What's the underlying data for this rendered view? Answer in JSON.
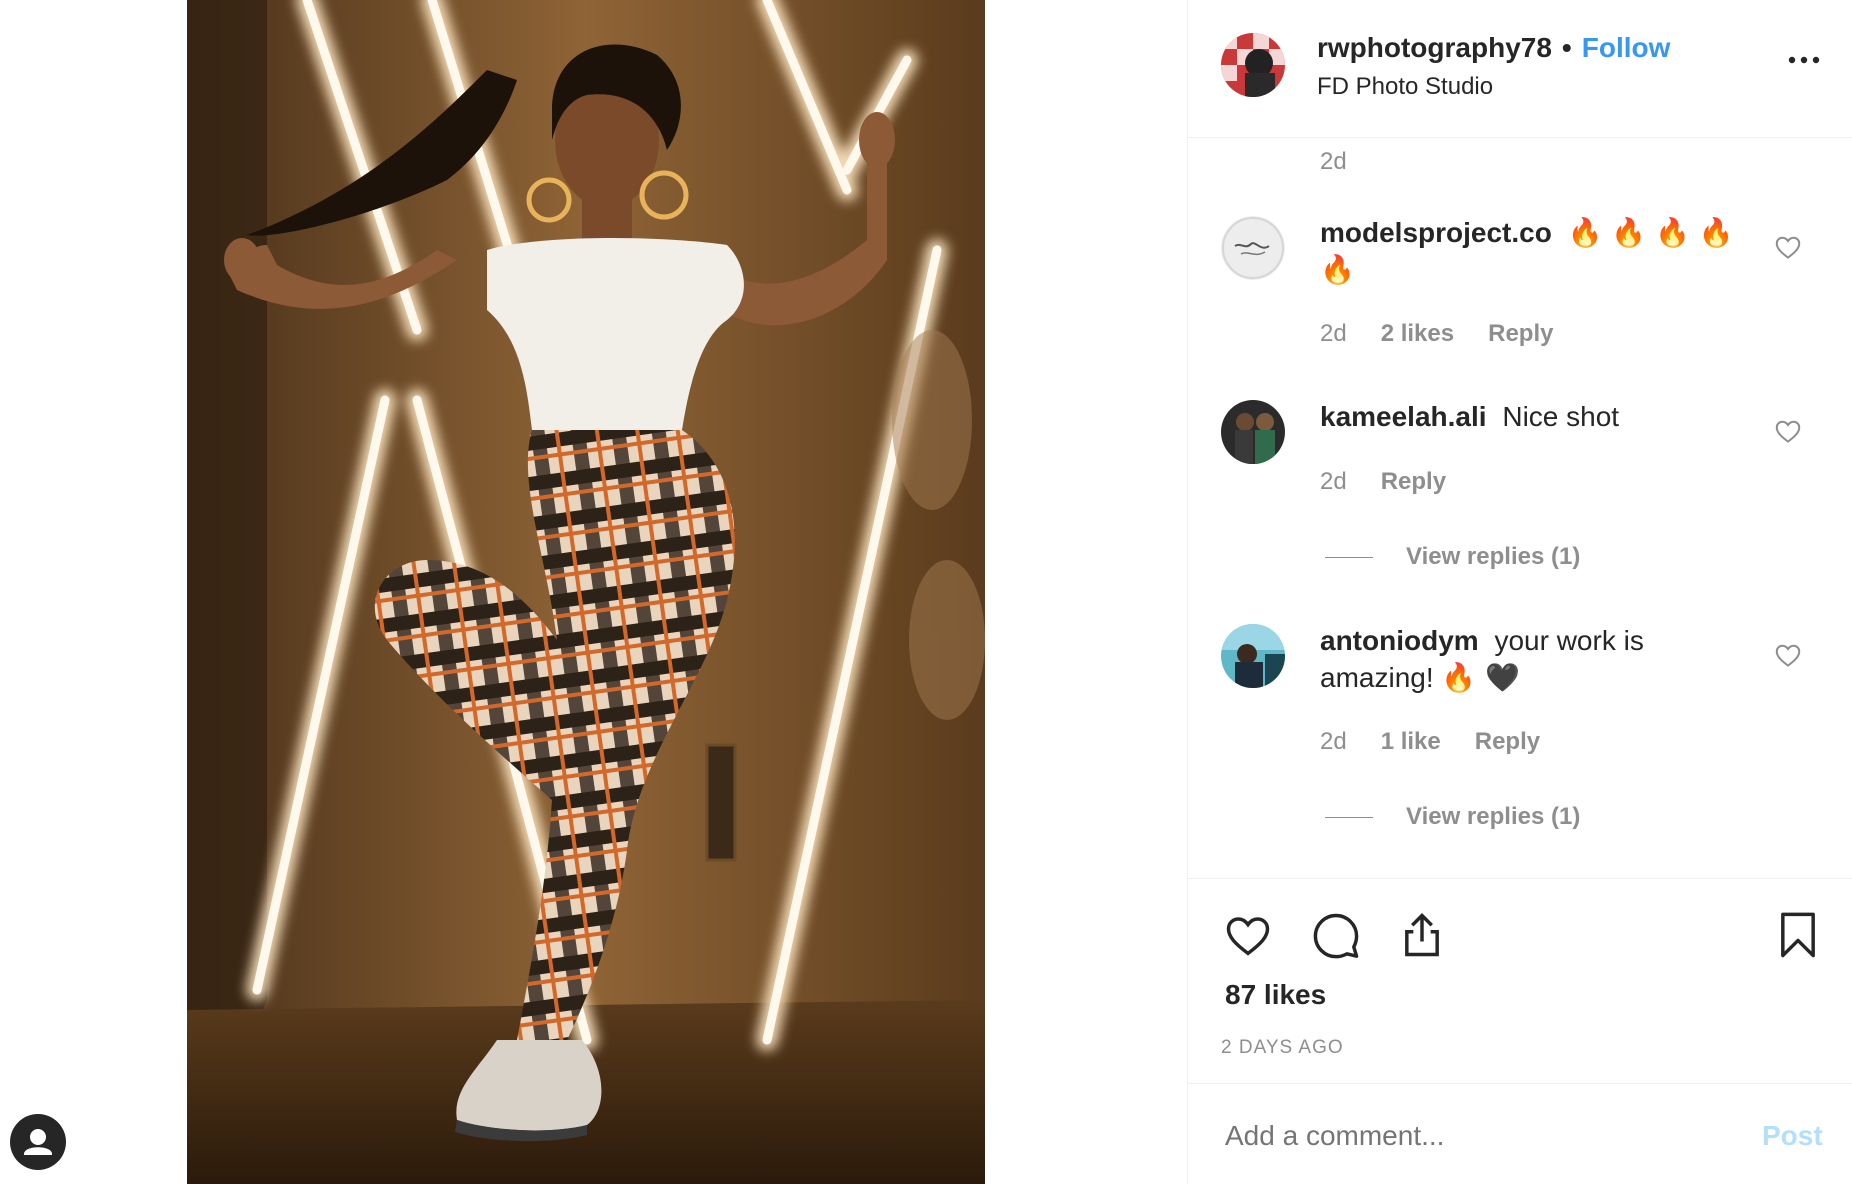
{
  "photo": {
    "alt_subject": "model-photo"
  },
  "post": {
    "username": "rwphotography78",
    "separator": "•",
    "follow_label": "Follow",
    "location": "FD Photo Studio",
    "caption_time": "2d"
  },
  "comments": [
    {
      "username": "modelsproject.co",
      "text": "🔥 🔥 🔥 🔥 🔥",
      "time": "2d",
      "likes": "2 likes",
      "reply": "Reply"
    },
    {
      "username": "kameelah.ali",
      "text": "Nice shot",
      "time": "2d",
      "reply": "Reply",
      "view_replies": "View replies (1)"
    },
    {
      "username": "antoniodym",
      "text": "your work is amazing!",
      "emoji": "🔥 🖤",
      "time": "2d",
      "likes": "1 like",
      "reply": "Reply",
      "view_replies": "View replies (1)"
    }
  ],
  "actions": {
    "like_count": "87 likes",
    "date": "2 DAYS AGO"
  },
  "composer": {
    "placeholder": "Add a comment...",
    "post_label": "Post"
  },
  "colors": {
    "link": "#3897f0",
    "muted": "#8e8e8e",
    "text": "#262626",
    "post_disabled": "#b2dffc"
  },
  "icons": [
    "heart-icon",
    "comment-icon",
    "share-icon",
    "bookmark-icon",
    "more-options-icon",
    "user-icon"
  ]
}
